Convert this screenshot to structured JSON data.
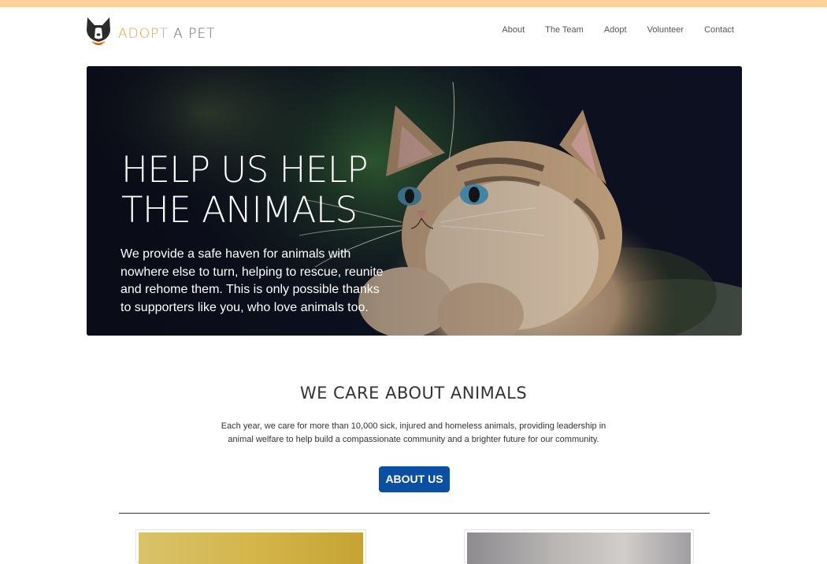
{
  "brand": {
    "word1": "ADOPT",
    "word2": "A PET",
    "accent_color": "#f0a02a",
    "top_bar_color": "#ffd29a",
    "logo_icon": "dog-face-icon"
  },
  "nav": {
    "items": [
      {
        "label": "About"
      },
      {
        "label": "The Team"
      },
      {
        "label": "Adopt"
      },
      {
        "label": "Volunteer"
      },
      {
        "label": "Contact"
      }
    ]
  },
  "hero": {
    "title_line1": "HELP US HELP",
    "title_line2": "THE ANIMALS",
    "text": "We provide a safe haven for animals with nowhere else to turn, helping to rescue, reunite and rehome them. This is only possible thanks to supporters like you, who love animals too.",
    "image": "kitten-photo"
  },
  "about": {
    "title": "WE CARE ABOUT ANIMALS",
    "text": "Each year, we care for more than 10,000 sick, injured and homeless animals, providing leadership in animal welfare to help build a compassionate community and a brighter future for our community.",
    "button_label": "ABOUT US",
    "button_color": "#0b4fa3"
  }
}
